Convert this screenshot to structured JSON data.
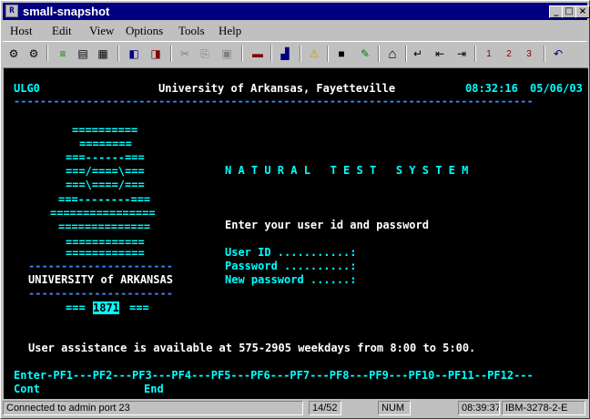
{
  "window": {
    "title": "small-snapshot"
  },
  "menus": [
    "Host",
    "Edit",
    "View",
    "Options",
    "Tools",
    "Help"
  ],
  "toolbar": [
    {
      "name": "connect-icon",
      "glyph": "⚙"
    },
    {
      "name": "disconnect-icon",
      "glyph": "⚙"
    },
    {
      "name": "send-file-icon",
      "glyph": "≡"
    },
    {
      "name": "receive-file-icon",
      "glyph": "▤"
    },
    {
      "name": "print-icon",
      "glyph": "▦"
    },
    {
      "name": "macro-record-icon",
      "glyph": "◧"
    },
    {
      "name": "macro-play-icon",
      "glyph": "◨"
    },
    {
      "name": "cut-icon",
      "glyph": "✂"
    },
    {
      "name": "copy-icon",
      "glyph": "⎘"
    },
    {
      "name": "paste-icon",
      "glyph": "▣"
    },
    {
      "name": "keypad-icon",
      "glyph": "▬"
    },
    {
      "name": "chart-icon",
      "glyph": "▟"
    },
    {
      "name": "warning-icon",
      "glyph": "⚠"
    },
    {
      "name": "screen-icon",
      "glyph": "■"
    },
    {
      "name": "pen-icon",
      "glyph": "✎"
    },
    {
      "name": "home-icon",
      "glyph": "⌂"
    },
    {
      "name": "enter-icon",
      "glyph": "↵"
    },
    {
      "name": "field-back-icon",
      "glyph": "⇤"
    },
    {
      "name": "field-forward-icon",
      "glyph": "⇥"
    },
    {
      "name": "session-1-icon",
      "glyph": "1"
    },
    {
      "name": "session-2-icon",
      "glyph": "2"
    },
    {
      "name": "session-3-icon",
      "glyph": "3"
    },
    {
      "name": "undo-icon",
      "glyph": "↶"
    }
  ],
  "screen": {
    "screen_id": "ULG0",
    "institution": "University of Arkansas, Fayetteville",
    "time": "08:32:16",
    "date": "05/06/03",
    "dashes": "-------------------------------------------------------------------------------",
    "logo": {
      "l1": "==========",
      "l2": "========",
      "l3": "===------===",
      "l4": "===/====\\===",
      "l5": "===\\====/===",
      "l6": "===--------===",
      "l7": "================",
      "l8": "==============",
      "l9": "============",
      "l10": "============",
      "dash_top": "----------------------",
      "name": "UNIVERSITY of ARKANSAS",
      "dash_bottom": "----------------------",
      "year_left": "===",
      "year": "1871",
      "year_right": "==="
    },
    "system_title": "N A T U R A L   T E S T   S Y S T E M",
    "prompt": "Enter your user id and password",
    "fields": {
      "userid_label": "User ID ...........:",
      "password_label": "Password ..........:",
      "newpassword_label": "New password ......:"
    },
    "assistance": "User assistance is available at 575-2905 weekdays from 8:00 to 5:00.",
    "pfkeys": "Enter-PF1---PF2---PF3---PF4---PF5---PF6---PF7---PF8---PF9---PF10--PF11--PF12---",
    "pf_cont": "Cont",
    "pf_end": "End"
  },
  "status": {
    "connection": "Connected to admin port 23",
    "cursor": "14/52",
    "num": "NUM",
    "clock": "08:39:37",
    "terminal": "IBM-3278-2-E"
  }
}
